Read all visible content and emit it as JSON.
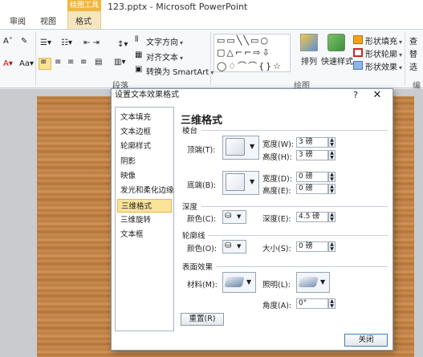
{
  "window": {
    "context_group": "绘图工具",
    "tabs": [
      "审阅",
      "视图",
      "格式"
    ],
    "doc_title": "123.pptx - Microsoft PowerPoint"
  },
  "ribbon": {
    "paragraph": {
      "text_direction": "文字方向",
      "align_text": "对齐文本",
      "convert_smartart": "转换为 SmartArt",
      "group_label": "段落"
    },
    "drawing": {
      "arrange": "排列",
      "quick_styles": "快速样式",
      "shape_fill": "形状填充",
      "shape_outline": "形状轮廓",
      "shape_effects": "形状效果",
      "group_label": "绘图"
    },
    "cut_labels": [
      "查",
      "替",
      "选"
    ],
    "cut_group": "编"
  },
  "dialog": {
    "title": "设置文本效果格式",
    "help": "?",
    "close_glyph": "✕",
    "nav": [
      "文本填充",
      "文本边框",
      "轮廓样式",
      "阴影",
      "映像",
      "发光和柔化边缘",
      "三维格式",
      "三维旋转",
      "文本框"
    ],
    "selected_nav": 6,
    "content": {
      "heading": "三维格式",
      "bevel": {
        "title": "棱台",
        "top": "顶端(T):",
        "bottom": "底端(B):",
        "width": "宽度(W):",
        "height": "高度(H):",
        "width2": "宽度(D):",
        "height2": "高度(E):",
        "top_width": "3 磅",
        "top_height": "3 磅",
        "bottom_width": "0 磅",
        "bottom_height": "0 磅"
      },
      "depth": {
        "title": "深度",
        "color": "颜色(C):",
        "depth_label": "深度(E):",
        "depth_value": "4.5 磅"
      },
      "contour": {
        "title": "轮廓线",
        "color": "颜色(O):",
        "size_label": "大小(S):",
        "size_value": "0 磅"
      },
      "surface": {
        "title": "表面效果",
        "material": "材料(M):",
        "lighting": "照明(L):",
        "angle_label": "角度(A):",
        "angle_value": "0°"
      },
      "reset": "重置(R)"
    },
    "close_button": "关闭"
  },
  "colors": {
    "context_accent": "#f0b63c",
    "nav_selected": "#fbe39a",
    "wood": "#c88a4c"
  }
}
